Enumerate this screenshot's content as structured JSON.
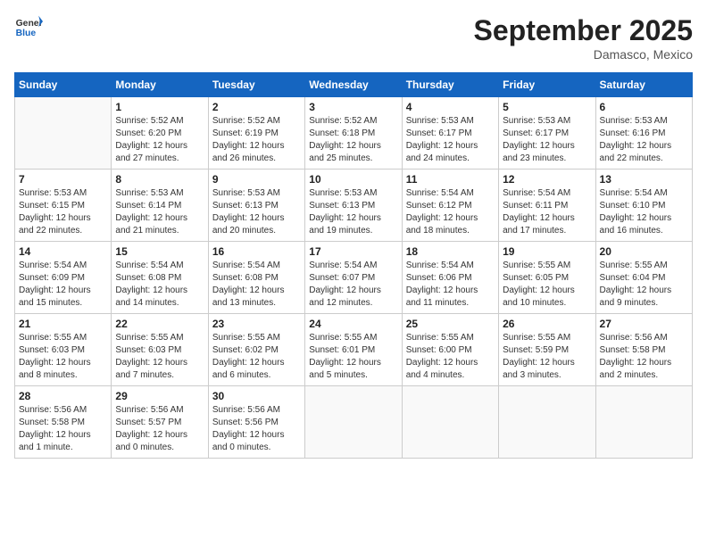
{
  "header": {
    "logo_line1": "General",
    "logo_line2": "Blue",
    "month": "September 2025",
    "location": "Damasco, Mexico"
  },
  "calendar": {
    "days_of_week": [
      "Sunday",
      "Monday",
      "Tuesday",
      "Wednesday",
      "Thursday",
      "Friday",
      "Saturday"
    ],
    "weeks": [
      [
        {
          "day": "",
          "info": ""
        },
        {
          "day": "1",
          "info": "Sunrise: 5:52 AM\nSunset: 6:20 PM\nDaylight: 12 hours\nand 27 minutes."
        },
        {
          "day": "2",
          "info": "Sunrise: 5:52 AM\nSunset: 6:19 PM\nDaylight: 12 hours\nand 26 minutes."
        },
        {
          "day": "3",
          "info": "Sunrise: 5:52 AM\nSunset: 6:18 PM\nDaylight: 12 hours\nand 25 minutes."
        },
        {
          "day": "4",
          "info": "Sunrise: 5:53 AM\nSunset: 6:17 PM\nDaylight: 12 hours\nand 24 minutes."
        },
        {
          "day": "5",
          "info": "Sunrise: 5:53 AM\nSunset: 6:17 PM\nDaylight: 12 hours\nand 23 minutes."
        },
        {
          "day": "6",
          "info": "Sunrise: 5:53 AM\nSunset: 6:16 PM\nDaylight: 12 hours\nand 22 minutes."
        }
      ],
      [
        {
          "day": "7",
          "info": "Sunrise: 5:53 AM\nSunset: 6:15 PM\nDaylight: 12 hours\nand 22 minutes."
        },
        {
          "day": "8",
          "info": "Sunrise: 5:53 AM\nSunset: 6:14 PM\nDaylight: 12 hours\nand 21 minutes."
        },
        {
          "day": "9",
          "info": "Sunrise: 5:53 AM\nSunset: 6:13 PM\nDaylight: 12 hours\nand 20 minutes."
        },
        {
          "day": "10",
          "info": "Sunrise: 5:53 AM\nSunset: 6:13 PM\nDaylight: 12 hours\nand 19 minutes."
        },
        {
          "day": "11",
          "info": "Sunrise: 5:54 AM\nSunset: 6:12 PM\nDaylight: 12 hours\nand 18 minutes."
        },
        {
          "day": "12",
          "info": "Sunrise: 5:54 AM\nSunset: 6:11 PM\nDaylight: 12 hours\nand 17 minutes."
        },
        {
          "day": "13",
          "info": "Sunrise: 5:54 AM\nSunset: 6:10 PM\nDaylight: 12 hours\nand 16 minutes."
        }
      ],
      [
        {
          "day": "14",
          "info": "Sunrise: 5:54 AM\nSunset: 6:09 PM\nDaylight: 12 hours\nand 15 minutes."
        },
        {
          "day": "15",
          "info": "Sunrise: 5:54 AM\nSunset: 6:08 PM\nDaylight: 12 hours\nand 14 minutes."
        },
        {
          "day": "16",
          "info": "Sunrise: 5:54 AM\nSunset: 6:08 PM\nDaylight: 12 hours\nand 13 minutes."
        },
        {
          "day": "17",
          "info": "Sunrise: 5:54 AM\nSunset: 6:07 PM\nDaylight: 12 hours\nand 12 minutes."
        },
        {
          "day": "18",
          "info": "Sunrise: 5:54 AM\nSunset: 6:06 PM\nDaylight: 12 hours\nand 11 minutes."
        },
        {
          "day": "19",
          "info": "Sunrise: 5:55 AM\nSunset: 6:05 PM\nDaylight: 12 hours\nand 10 minutes."
        },
        {
          "day": "20",
          "info": "Sunrise: 5:55 AM\nSunset: 6:04 PM\nDaylight: 12 hours\nand 9 minutes."
        }
      ],
      [
        {
          "day": "21",
          "info": "Sunrise: 5:55 AM\nSunset: 6:03 PM\nDaylight: 12 hours\nand 8 minutes."
        },
        {
          "day": "22",
          "info": "Sunrise: 5:55 AM\nSunset: 6:03 PM\nDaylight: 12 hours\nand 7 minutes."
        },
        {
          "day": "23",
          "info": "Sunrise: 5:55 AM\nSunset: 6:02 PM\nDaylight: 12 hours\nand 6 minutes."
        },
        {
          "day": "24",
          "info": "Sunrise: 5:55 AM\nSunset: 6:01 PM\nDaylight: 12 hours\nand 5 minutes."
        },
        {
          "day": "25",
          "info": "Sunrise: 5:55 AM\nSunset: 6:00 PM\nDaylight: 12 hours\nand 4 minutes."
        },
        {
          "day": "26",
          "info": "Sunrise: 5:55 AM\nSunset: 5:59 PM\nDaylight: 12 hours\nand 3 minutes."
        },
        {
          "day": "27",
          "info": "Sunrise: 5:56 AM\nSunset: 5:58 PM\nDaylight: 12 hours\nand 2 minutes."
        }
      ],
      [
        {
          "day": "28",
          "info": "Sunrise: 5:56 AM\nSunset: 5:58 PM\nDaylight: 12 hours\nand 1 minute."
        },
        {
          "day": "29",
          "info": "Sunrise: 5:56 AM\nSunset: 5:57 PM\nDaylight: 12 hours\nand 0 minutes."
        },
        {
          "day": "30",
          "info": "Sunrise: 5:56 AM\nSunset: 5:56 PM\nDaylight: 12 hours\nand 0 minutes."
        },
        {
          "day": "",
          "info": ""
        },
        {
          "day": "",
          "info": ""
        },
        {
          "day": "",
          "info": ""
        },
        {
          "day": "",
          "info": ""
        }
      ]
    ]
  }
}
